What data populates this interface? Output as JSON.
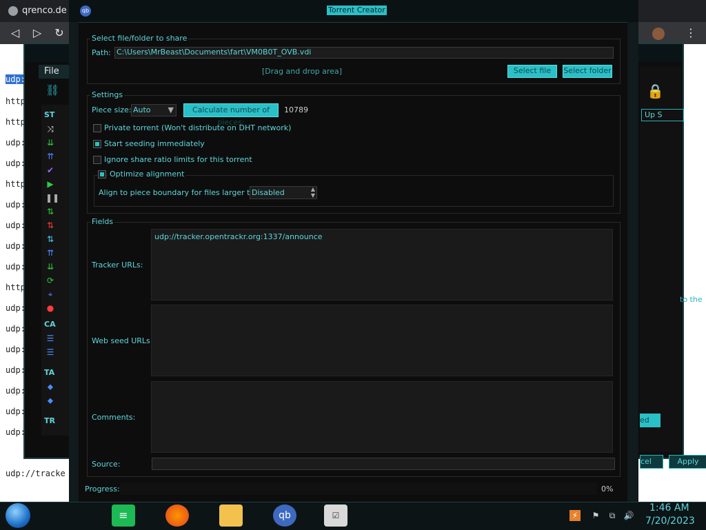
{
  "browser": {
    "tab_title": "qrenco.de",
    "back": "◁",
    "forward": "▷",
    "reload": "↻",
    "menu": "⋮",
    "page_lines": [
      "udp:",
      "http",
      "http",
      "udp:",
      "udp:",
      "http",
      "udp:",
      "udp:",
      "udp:",
      "udp:",
      "http",
      "udp:",
      "udp:",
      "udp:",
      "udp:",
      "udp:",
      "udp:",
      "udp:",
      "udp://tracke"
    ],
    "highlight": "udp:"
  },
  "qb_main": {
    "menu_file": "File",
    "sidebar_heads": [
      "ST",
      "CA",
      "TA",
      "TR"
    ],
    "up_speed_col": "Up S",
    "to_the": "to the",
    "cancel": "cel",
    "apply": "Apply",
    "speed_btn": "ed"
  },
  "torrent_creator": {
    "title": "Torrent Creator",
    "file_group": "Select file/folder to share",
    "path_label": "Path:",
    "path_value": "C:\\Users\\MrBeast\\Documents\\fart\\VM0B0T_OVB.vdi",
    "drag_drop": "[Drag and drop area]",
    "select_file": "Select file",
    "select_folder": "Select folder",
    "settings_group": "Settings",
    "piece_size_label": "Piece size:",
    "piece_size_value": "Auto",
    "calc_pieces": "Calculate number of pieces:",
    "pieces_count": "10789",
    "private_torrent": "Private torrent (Won't distribute on DHT network)",
    "start_seeding": "Start seeding immediately",
    "ignore_ratio": "Ignore share ratio limits for this torrent",
    "optimize_alignment": "Optimize alignment",
    "align_label": "Align to piece boundary for files larger than:",
    "align_value": "Disabled",
    "fields_group": "Fields",
    "tracker_label": "Tracker URLs:",
    "tracker_value": "udp://tracker.opentrackr.org:1337/announce",
    "webseed_label": "Web seed URLs:",
    "webseed_value": "",
    "comments_label": "Comments:",
    "comments_value": "",
    "source_label": "Source:",
    "source_value": "",
    "progress_label": "Progress:",
    "progress_value": "0%",
    "checks": {
      "private": false,
      "start_seeding": true,
      "ignore_ratio": false,
      "optimize": true
    }
  },
  "taskbar": {
    "time": "1:46 AM",
    "date": "7/20/2023",
    "apps": [
      "notes-app-icon",
      "firefox-icon",
      "file-explorer-icon",
      "qbittorrent-icon",
      "task-icon"
    ]
  },
  "colors": {
    "accent": "#2bbfc7",
    "text_accent": "#5fd6dc",
    "bg": "#0d0d0d"
  }
}
